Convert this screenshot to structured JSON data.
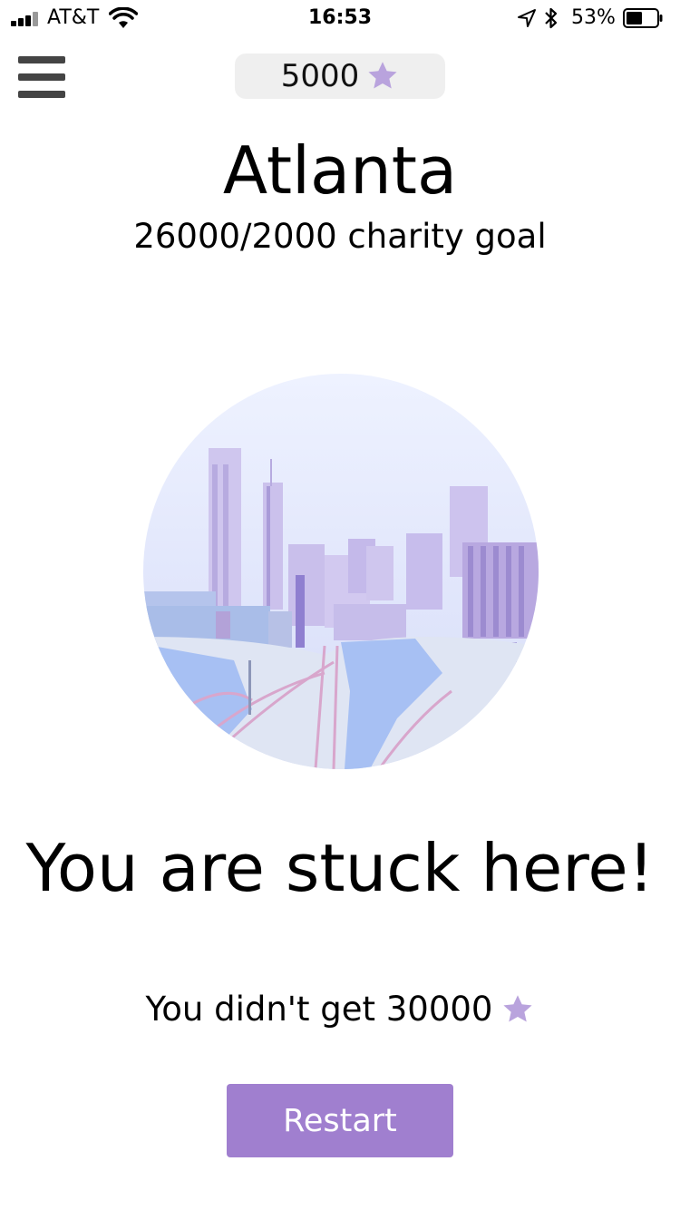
{
  "status_bar": {
    "carrier": "AT&T",
    "time": "16:53",
    "battery_percent": "53%",
    "battery_level": 0.53,
    "icons": [
      "signal-icon",
      "wifi-icon",
      "location-arrow-icon",
      "bluetooth-icon",
      "battery-icon"
    ]
  },
  "header": {
    "menu_icon": "hamburger-menu-icon",
    "points": "5000",
    "points_icon": "star-icon"
  },
  "city": {
    "name": "Atlanta",
    "goal": "26000/2000 charity goal"
  },
  "result": {
    "headline": "You are stuck here!",
    "missed_text": "You didn't get 30000",
    "missed_icon": "star-icon"
  },
  "actions": {
    "restart_label": "Restart"
  },
  "colors": {
    "accent": "#a07fcf",
    "star": "#b9a3dd",
    "pill_bg": "#efefef",
    "menu_icon": "#444444"
  }
}
